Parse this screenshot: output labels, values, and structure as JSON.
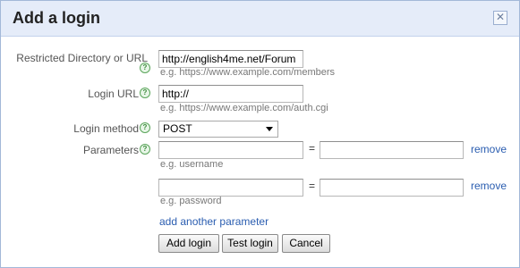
{
  "dialog": {
    "title": "Add a login",
    "close_symbol": "✕"
  },
  "help_glyph": "?",
  "fields": {
    "restricted_url": {
      "label": "Restricted Directory or URL",
      "value": "http://english4me.net/Forum",
      "hint": "e.g. https://www.example.com/members"
    },
    "login_url": {
      "label": "Login URL",
      "value": "http://",
      "hint": "e.g. https://www.example.com/auth.cgi"
    },
    "login_method": {
      "label": "Login method",
      "selected": "POST"
    },
    "parameters": {
      "label": "Parameters",
      "equals": "=",
      "rows": [
        {
          "name_value": "",
          "value_value": "",
          "hint": "e.g. username",
          "remove_label": "remove"
        },
        {
          "name_value": "",
          "value_value": "",
          "hint": "e.g. password",
          "remove_label": "remove"
        }
      ],
      "add_label": "add another parameter"
    }
  },
  "buttons": {
    "add_login": "Add login",
    "test_login": "Test login",
    "cancel": "Cancel"
  }
}
